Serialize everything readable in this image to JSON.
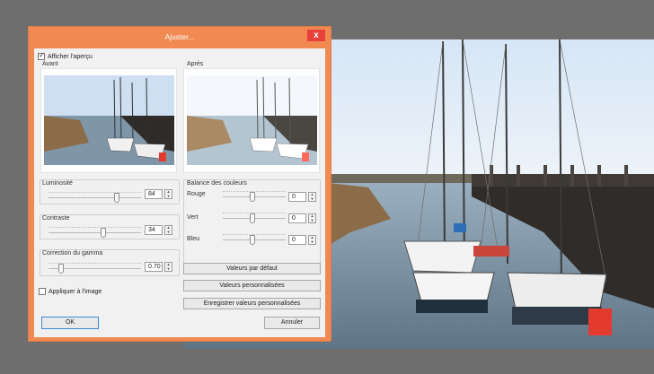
{
  "dialog": {
    "title": "Ajuster...",
    "close_glyph": "x",
    "preview_checkbox": {
      "label": "Afficher l'aperçu",
      "checked": true
    },
    "before_label": "Avant",
    "after_label": "Après",
    "brightness": {
      "label": "Luminosité",
      "value": "84",
      "level": 0.72
    },
    "contrast": {
      "label": "Contraste",
      "value": "34",
      "level": 0.6
    },
    "gamma": {
      "label": "Correction du gamma",
      "value": "0.70",
      "level": 0.1
    },
    "color_balance": {
      "label": "Balance des couleurs",
      "red": {
        "label": "Rouge",
        "value": "0",
        "level": 0.5
      },
      "green": {
        "label": "Vert",
        "value": "0",
        "level": 0.5
      },
      "blue": {
        "label": "Bleu",
        "value": "0",
        "level": 0.5
      }
    },
    "apply_checkbox": {
      "label": "Appliquer à l'image",
      "checked": false
    },
    "buttons": {
      "defaults": "Valeurs par défaut",
      "custom": "Valeurs personnalisées",
      "save_custom": "Enregistrer valeurs personnalisées",
      "ok": "OK",
      "cancel": "Annuler"
    },
    "accent_color": "#f08a52",
    "close_color": "#e8403a"
  }
}
